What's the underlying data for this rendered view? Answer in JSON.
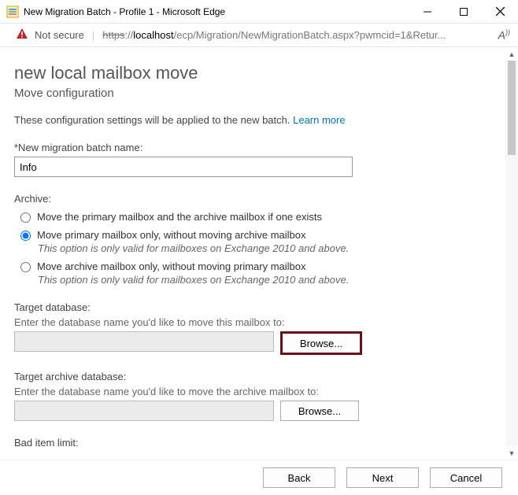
{
  "window": {
    "title": "New Migration Batch - Profile 1 - Microsoft Edge"
  },
  "addressbar": {
    "not_secure": "Not secure",
    "url_scheme": "https",
    "url_sep": "://",
    "url_host": "localhost",
    "url_path": "/ecp/Migration/NewMigrationBatch.aspx?pwmcid=1&Retur..."
  },
  "page": {
    "heading": "new local mailbox move",
    "subheading": "Move configuration",
    "description": "These configuration settings will be applied to the new batch. ",
    "learn_more": "Learn more"
  },
  "batch_name": {
    "label": "*New migration batch name:",
    "value": "Info"
  },
  "archive": {
    "legend": "Archive:",
    "options": [
      {
        "label": "Move the primary mailbox and the archive mailbox if one exists",
        "hint": ""
      },
      {
        "label": "Move primary mailbox only, without moving archive mailbox",
        "hint": "This option is only valid for mailboxes on Exchange 2010 and above."
      },
      {
        "label": "Move archive mailbox only, without moving primary mailbox",
        "hint": "This option is only valid for mailboxes on Exchange 2010 and above."
      }
    ],
    "selected_index": 1
  },
  "target_db": {
    "label": "Target database:",
    "help": "Enter the database name you'd like to move this mailbox to:",
    "value": "",
    "browse": "Browse..."
  },
  "target_archive_db": {
    "label": "Target archive database:",
    "help": "Enter the database name you'd like to move the archive mailbox to:",
    "value": "",
    "browse": "Browse..."
  },
  "bad_item": {
    "label": "Bad item limit:"
  },
  "footer": {
    "back": "Back",
    "next": "Next",
    "cancel": "Cancel"
  }
}
